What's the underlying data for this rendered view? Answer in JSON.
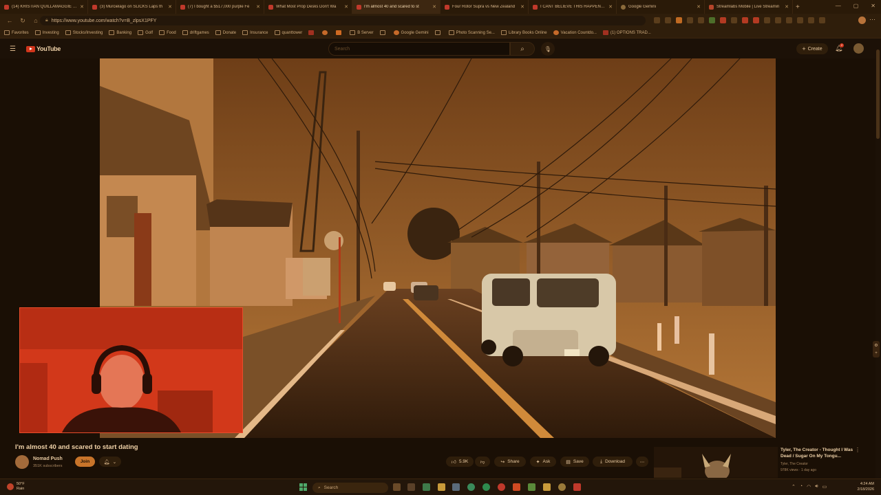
{
  "browser": {
    "tabs": [
      {
        "title": "(14) KRISTIAN QUILLAMAGGIE - N",
        "active": false
      },
      {
        "title": "(3) Murcielago on SLICKS Laps th",
        "active": false
      },
      {
        "title": "(7) I bought a $517,000 purple Fe",
        "active": false
      },
      {
        "title": "What Most Prop Desks Don't Wa",
        "active": false
      },
      {
        "title": "I'm almost 40 and scared to st",
        "active": true
      },
      {
        "title": "Four Rotor Supra vs New Zealand",
        "active": false
      },
      {
        "title": "I CANT BELIEVE THIS HAPPENED -",
        "active": false
      },
      {
        "title": "Google Gemini",
        "active": false
      },
      {
        "title": "Streamlabs Mobile | Live Streamin",
        "active": false
      }
    ],
    "new_tab": "+",
    "url": "https://www.youtube.com/watch?v=B_zlpsX1PFY",
    "bookmarks": [
      "Favorites",
      "Investing",
      "Stocks/Investing",
      "Banking",
      "Golf",
      "Food",
      "driftgames",
      "Donate",
      "Insurance",
      "quanttower",
      "",
      "",
      "",
      "B Server",
      "",
      "Google Gemini",
      "",
      "Photo Scanning Se...",
      "Library Books Online",
      "Vacation Countdo...",
      "(1) OPTIONS TRAD..."
    ]
  },
  "youtube": {
    "logo": "YouTube",
    "search_placeholder": "Search",
    "create_label": "Create",
    "notification_count": "2"
  },
  "video": {
    "title": "I'm almost 40 and scared to start dating",
    "channel": "Nomad Push",
    "subscribers": "351K subscribers",
    "join_label": "Join",
    "likes": "5.9K",
    "share_label": "Share",
    "ask_label": "Ask",
    "save_label": "Save",
    "download_label": "Download"
  },
  "recommendation": {
    "title": "Tyler, The Creator - Thought I Was Dead / Sugar On My Tongu...",
    "channel": "Tyler, The Creator",
    "meta": "978K views · 1 day ago"
  },
  "taskbar": {
    "temp": "50°F",
    "weather": "Rain",
    "search_label": "Search",
    "time": "4:24 AM",
    "date": "2/18/2026"
  },
  "colors": {
    "tint": "#8a5425",
    "accent": "#c8742a",
    "brand_red": "#d1361c"
  }
}
